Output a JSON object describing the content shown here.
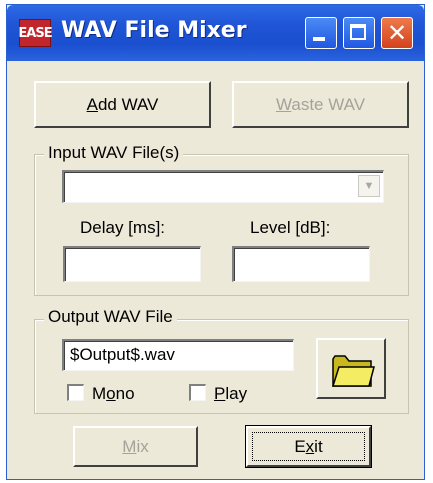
{
  "window": {
    "title": "WAV File Mixer",
    "icon_text": "EASE"
  },
  "buttons": {
    "add_wav_prefix": "",
    "add_wav_mnemonic": "A",
    "add_wav_rest": "dd WAV",
    "waste_wav_mnemonic": "W",
    "waste_wav_rest": "aste WAV",
    "mix_mnemonic": "M",
    "mix_rest": "ix",
    "exit_prefix": "E",
    "exit_mnemonic": "x",
    "exit_rest": "it"
  },
  "input_group": {
    "legend": "Input WAV File(s)",
    "file_select_value": "",
    "delay_label": "Delay [ms]:",
    "delay_value": "",
    "level_label": "Level [dB]:",
    "level_value": ""
  },
  "output_group": {
    "legend": "Output WAV File",
    "filename_value": "$Output$.wav",
    "mono_prefix": "M",
    "mono_mnemonic": "o",
    "mono_rest": "no",
    "mono_checked": false,
    "play_mnemonic": "P",
    "play_rest": "lay",
    "play_checked": false
  },
  "icons": {
    "browse": "folder-icon",
    "dropdown": "chevron-down-icon",
    "minimize": "minimize-icon",
    "maximize": "maximize-icon",
    "close": "close-icon"
  },
  "colors": {
    "titlebar": "#1f55d6",
    "close_button": "#d2421d",
    "dialog_bg": "#ece9d8",
    "disabled_text": "#a3a39a"
  }
}
